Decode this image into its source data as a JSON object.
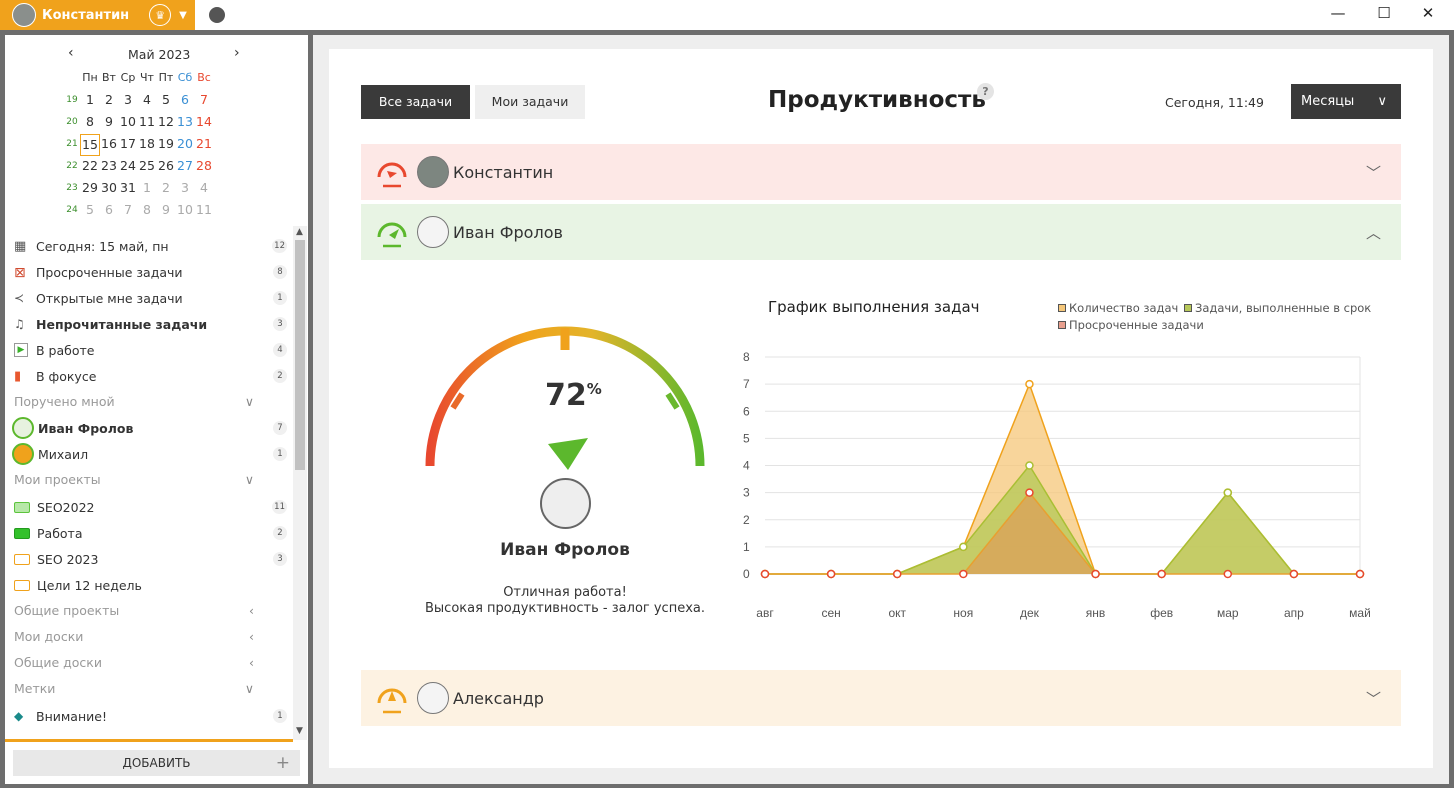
{
  "titlebar": {
    "user_name": "Константин",
    "minimize": "—",
    "maximize": "☐",
    "close": "✕"
  },
  "calendar": {
    "month_label": "Май 2023",
    "weekdays": [
      "Пн",
      "Вт",
      "Ср",
      "Чт",
      "Пт",
      "Сб",
      "Вс"
    ],
    "weeks": [
      {
        "num": "19",
        "days": [
          "1",
          "2",
          "3",
          "4",
          "5",
          "6",
          "7"
        ]
      },
      {
        "num": "20",
        "days": [
          "8",
          "9",
          "10",
          "11",
          "12",
          "13",
          "14"
        ]
      },
      {
        "num": "21",
        "days": [
          "15",
          "16",
          "17",
          "18",
          "19",
          "20",
          "21"
        ]
      },
      {
        "num": "22",
        "days": [
          "22",
          "23",
          "24",
          "25",
          "26",
          "27",
          "28"
        ]
      },
      {
        "num": "23",
        "days": [
          "29",
          "30",
          "31",
          "1",
          "2",
          "3",
          "4"
        ]
      },
      {
        "num": "24",
        "days": [
          "5",
          "6",
          "7",
          "8",
          "9",
          "10",
          "11"
        ]
      }
    ]
  },
  "sidebar": {
    "items": [
      {
        "label": "Сегодня: 15 май, пн",
        "count": "12"
      },
      {
        "label": "Просроченные задачи",
        "count": "8"
      },
      {
        "label": "Открытые мне задачи",
        "count": "1"
      },
      {
        "label": "Непрочитанные задачи",
        "count": "3"
      },
      {
        "label": "В работе",
        "count": "4"
      },
      {
        "label": "В фокусе",
        "count": "2"
      }
    ],
    "sec_assigned": "Поручено мной",
    "assigned": [
      {
        "label": "Иван Фролов",
        "count": "7"
      },
      {
        "label": "Михаил",
        "count": "1"
      }
    ],
    "sec_projects": "Мои проекты",
    "projects": [
      {
        "label": "SEO2022",
        "count": "11"
      },
      {
        "label": "Работа",
        "count": "2"
      },
      {
        "label": "SEO 2023",
        "count": "3"
      },
      {
        "label": "Цели 12 недель",
        "count": ""
      }
    ],
    "sec_shared_projects": "Общие проекты",
    "sec_my_boards": "Мои доски",
    "sec_shared_boards": "Общие доски",
    "sec_tags": "Метки",
    "tags": [
      {
        "label": "Внимание!",
        "count": "1"
      }
    ],
    "add_label": "ДОБАВИТЬ"
  },
  "main": {
    "tab_all": "Все задачи",
    "tab_mine": "Мои задачи",
    "title": "Продуктивность",
    "help": "?",
    "now": "Сегодня, 11:49",
    "period": "Месяцы",
    "people": [
      {
        "name": "Константин",
        "status": "low",
        "color": "#e8482f",
        "expanded": false
      },
      {
        "name": "Иван Фролов",
        "status": "high",
        "color": "#5cb82d",
        "expanded": true
      },
      {
        "name": "Александр",
        "status": "mid",
        "color": "#f0a21c",
        "expanded": false
      }
    ],
    "gauge": {
      "percent": "72",
      "percent_sign": "%",
      "value": 0.72,
      "name": "Иван Фролов",
      "msg1": "Отличная работа!",
      "msg2": "Высокая продуктивность - залог успеха."
    }
  },
  "chart_data": {
    "type": "area",
    "title": "График выполнения задач",
    "categories": [
      "авг",
      "сен",
      "окт",
      "ноя",
      "дек",
      "янв",
      "фев",
      "мар",
      "апр",
      "май"
    ],
    "ylim": [
      0,
      8
    ],
    "yticks": [
      "0",
      "1",
      "2",
      "3",
      "4",
      "5",
      "6",
      "7",
      "8"
    ],
    "series": [
      {
        "name": "Количество задач",
        "color": "#f0a21c",
        "fill": "#f5c77a",
        "values": [
          0,
          0,
          0,
          1,
          7,
          0,
          0,
          3,
          0,
          0
        ]
      },
      {
        "name": "Задачи, выполненные в срок",
        "color": "#9ac23c",
        "fill": "#b8c95a",
        "values": [
          0,
          0,
          0,
          1,
          4,
          0,
          0,
          3,
          0,
          0
        ]
      },
      {
        "name": "Просроченные задачи",
        "color": "#e8482f",
        "fill": "#d9a35a",
        "values": [
          0,
          0,
          0,
          0,
          3,
          0,
          0,
          0,
          0,
          0
        ]
      }
    ],
    "grid": true,
    "legend_position": "top-right"
  }
}
